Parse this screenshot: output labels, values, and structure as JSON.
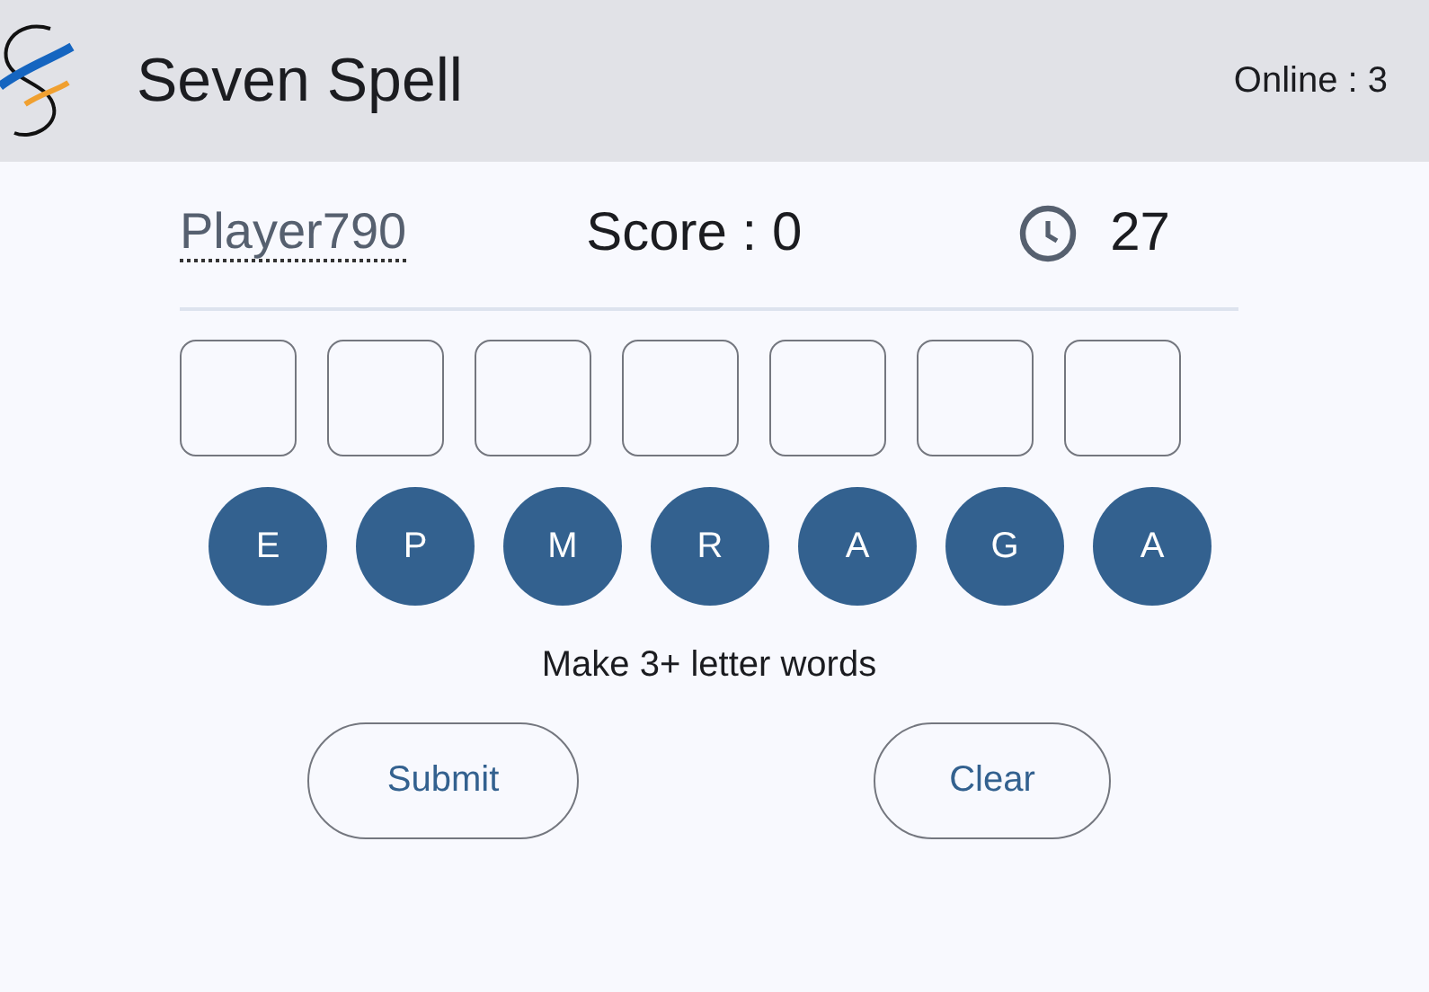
{
  "app_bar": {
    "title": "Seven Spell",
    "online": "Online : 3"
  },
  "status": {
    "player": "Player790",
    "score": "Score : 0",
    "time_left": "27"
  },
  "answer_slots": [
    {
      "filled": false
    },
    {
      "filled": false
    },
    {
      "filled": false
    },
    {
      "filled": false
    },
    {
      "filled": false
    },
    {
      "filled": false
    },
    {
      "filled": false
    }
  ],
  "letters": [
    {
      "letter": "E",
      "selected": false
    },
    {
      "letter": "P",
      "selected": false
    },
    {
      "letter": "M",
      "selected": false
    },
    {
      "letter": "R",
      "selected": false
    },
    {
      "letter": "A",
      "selected": false
    },
    {
      "letter": "G",
      "selected": false
    },
    {
      "letter": "A",
      "selected": false
    }
  ],
  "hint": "Make 3+ letter words",
  "buttons": [
    "Submit",
    "Clear"
  ]
}
